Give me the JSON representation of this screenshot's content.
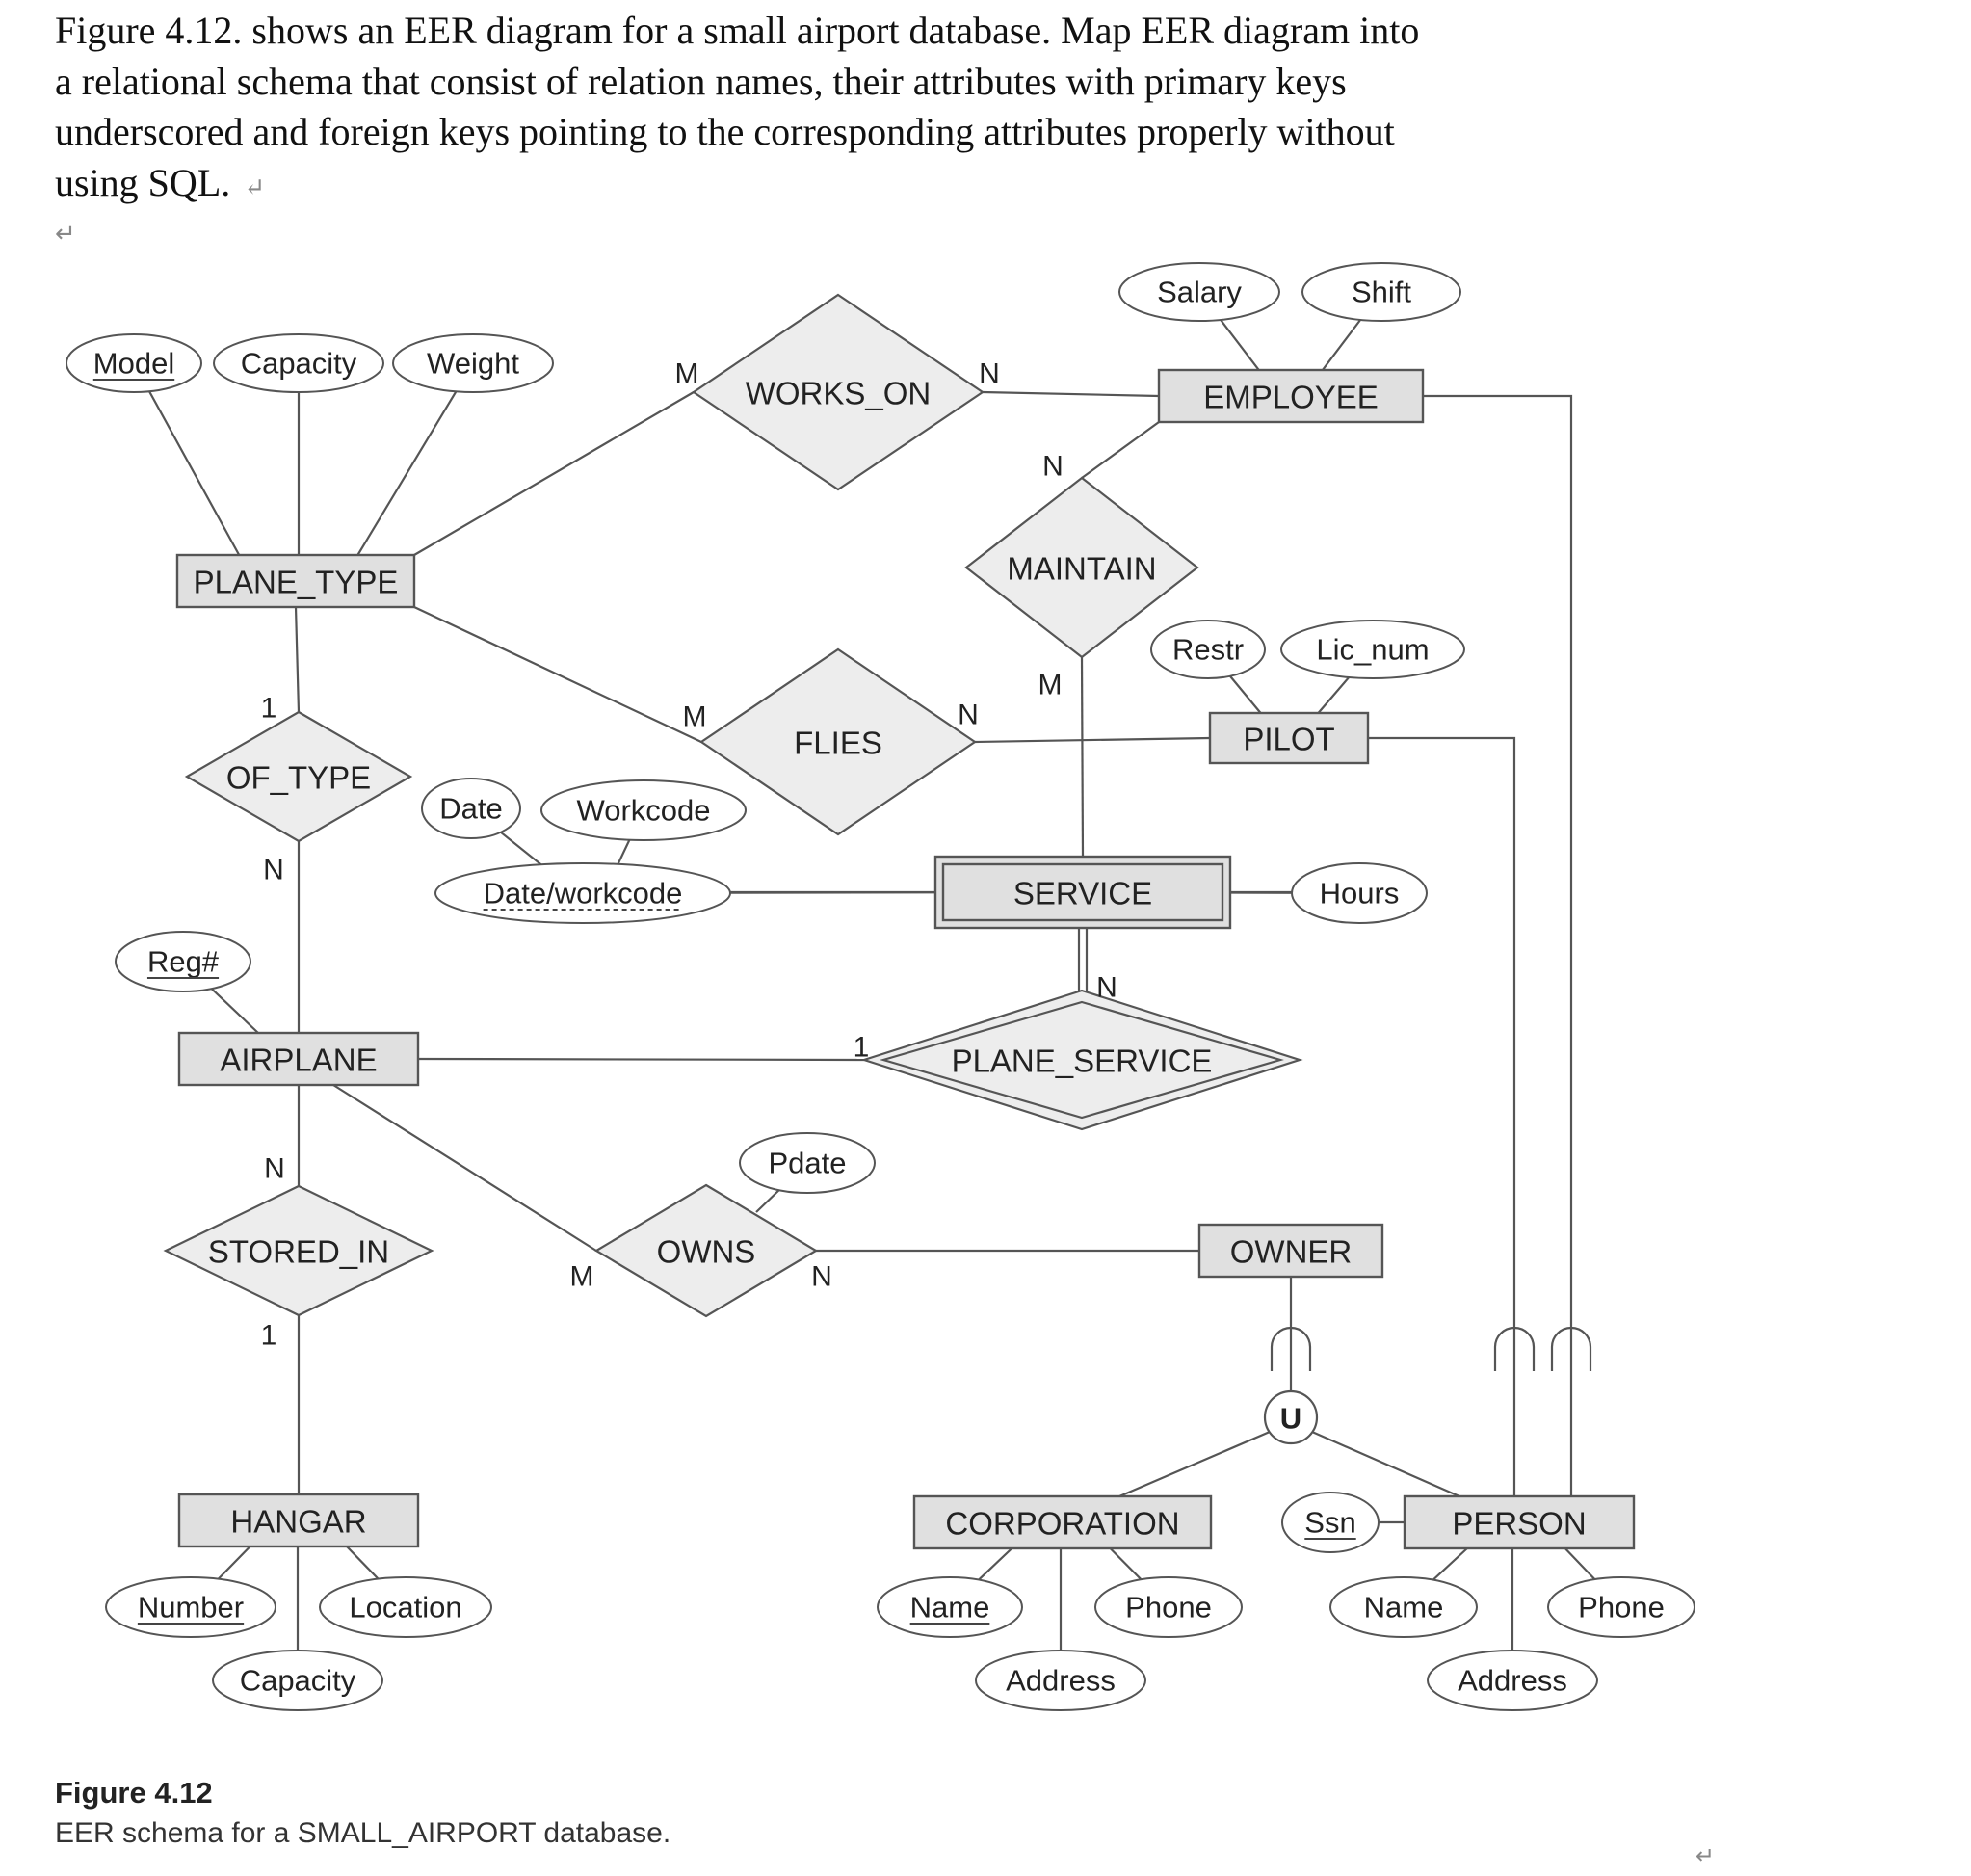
{
  "question": {
    "lines": [
      "Figure 4.12. shows an EER diagram for a small airport database. Map EER diagram into",
      "a relational schema that consist of relation names, their attributes with primary keys",
      "underscored and foreign keys pointing to the corresponding attributes properly without",
      "using SQL."
    ],
    "paragraph_mark": "↵"
  },
  "diagram": {
    "entities": [
      {
        "id": "PLANE_TYPE",
        "label": "PLANE_TYPE",
        "weak": false
      },
      {
        "id": "EMPLOYEE",
        "label": "EMPLOYEE",
        "weak": false
      },
      {
        "id": "PILOT",
        "label": "PILOT",
        "weak": false
      },
      {
        "id": "SERVICE",
        "label": "SERVICE",
        "weak": true
      },
      {
        "id": "AIRPLANE",
        "label": "AIRPLANE",
        "weak": false
      },
      {
        "id": "OWNER",
        "label": "OWNER",
        "weak": false
      },
      {
        "id": "HANGAR",
        "label": "HANGAR",
        "weak": false
      },
      {
        "id": "CORPORATION",
        "label": "CORPORATION",
        "weak": false
      },
      {
        "id": "PERSON",
        "label": "PERSON",
        "weak": false
      }
    ],
    "relationships": [
      {
        "id": "WORKS_ON",
        "label": "WORKS_ON",
        "identifying": false
      },
      {
        "id": "MAINTAIN",
        "label": "MAINTAIN",
        "identifying": false
      },
      {
        "id": "FLIES",
        "label": "FLIES",
        "identifying": false
      },
      {
        "id": "OF_TYPE",
        "label": "OF_TYPE",
        "identifying": false
      },
      {
        "id": "PLANE_SERVICE",
        "label": "PLANE_SERVICE",
        "identifying": true
      },
      {
        "id": "STORED_IN",
        "label": "STORED_IN",
        "identifying": false
      },
      {
        "id": "OWNS",
        "label": "OWNS",
        "identifying": false
      }
    ],
    "attributes": [
      {
        "id": "pt_model",
        "owner": "PLANE_TYPE",
        "label": "Model",
        "key": "primary"
      },
      {
        "id": "pt_capacity",
        "owner": "PLANE_TYPE",
        "label": "Capacity",
        "key": "none"
      },
      {
        "id": "pt_weight",
        "owner": "PLANE_TYPE",
        "label": "Weight",
        "key": "none"
      },
      {
        "id": "emp_salary",
        "owner": "EMPLOYEE",
        "label": "Salary",
        "key": "none"
      },
      {
        "id": "emp_shift",
        "owner": "EMPLOYEE",
        "label": "Shift",
        "key": "none"
      },
      {
        "id": "pil_restr",
        "owner": "PILOT",
        "label": "Restr",
        "key": "none"
      },
      {
        "id": "pil_lic",
        "owner": "PILOT",
        "label": "Lic_num",
        "key": "none"
      },
      {
        "id": "svc_date",
        "owner": "svc_dw",
        "label": "Date",
        "key": "none"
      },
      {
        "id": "svc_workcode",
        "owner": "svc_dw",
        "label": "Workcode",
        "key": "none"
      },
      {
        "id": "svc_dw",
        "owner": "SERVICE",
        "label": "Date/workcode",
        "key": "partial"
      },
      {
        "id": "svc_hours",
        "owner": "SERVICE",
        "label": "Hours",
        "key": "none"
      },
      {
        "id": "ap_reg",
        "owner": "AIRPLANE",
        "label": "Reg#",
        "key": "primary"
      },
      {
        "id": "owns_pdate",
        "owner": "OWNS",
        "label": "Pdate",
        "key": "none"
      },
      {
        "id": "hg_number",
        "owner": "HANGAR",
        "label": "Number",
        "key": "primary"
      },
      {
        "id": "hg_location",
        "owner": "HANGAR",
        "label": "Location",
        "key": "none"
      },
      {
        "id": "hg_capacity",
        "owner": "HANGAR",
        "label": "Capacity",
        "key": "none"
      },
      {
        "id": "corp_name",
        "owner": "CORPORATION",
        "label": "Name",
        "key": "primary"
      },
      {
        "id": "corp_phone",
        "owner": "CORPORATION",
        "label": "Phone",
        "key": "none"
      },
      {
        "id": "corp_address",
        "owner": "CORPORATION",
        "label": "Address",
        "key": "none"
      },
      {
        "id": "per_ssn",
        "owner": "PERSON",
        "label": "Ssn",
        "key": "primary"
      },
      {
        "id": "per_name",
        "owner": "PERSON",
        "label": "Name",
        "key": "none"
      },
      {
        "id": "per_phone",
        "owner": "PERSON",
        "label": "Phone",
        "key": "none"
      },
      {
        "id": "per_address",
        "owner": "PERSON",
        "label": "Address",
        "key": "none"
      }
    ],
    "cardinalities": [
      {
        "id": "c_wo_pt",
        "relationship": "WORKS_ON",
        "entity": "PLANE_TYPE",
        "label": "M"
      },
      {
        "id": "c_wo_emp",
        "relationship": "WORKS_ON",
        "entity": "EMPLOYEE",
        "label": "N"
      },
      {
        "id": "c_mt_emp",
        "relationship": "MAINTAIN",
        "entity": "EMPLOYEE",
        "label": "N"
      },
      {
        "id": "c_mt_svc",
        "relationship": "MAINTAIN",
        "entity": "SERVICE",
        "label": "M"
      },
      {
        "id": "c_fl_pt",
        "relationship": "FLIES",
        "entity": "PLANE_TYPE",
        "label": "M"
      },
      {
        "id": "c_fl_pil",
        "relationship": "FLIES",
        "entity": "PILOT",
        "label": "N"
      },
      {
        "id": "c_ot_pt",
        "relationship": "OF_TYPE",
        "entity": "PLANE_TYPE",
        "label": "1"
      },
      {
        "id": "c_ot_ap",
        "relationship": "OF_TYPE",
        "entity": "AIRPLANE",
        "label": "N"
      },
      {
        "id": "c_ps_svc",
        "relationship": "PLANE_SERVICE",
        "entity": "SERVICE",
        "label": "N"
      },
      {
        "id": "c_ps_ap",
        "relationship": "PLANE_SERVICE",
        "entity": "AIRPLANE",
        "label": "1"
      },
      {
        "id": "c_si_ap",
        "relationship": "STORED_IN",
        "entity": "AIRPLANE",
        "label": "N"
      },
      {
        "id": "c_si_hg",
        "relationship": "STORED_IN",
        "entity": "HANGAR",
        "label": "1"
      },
      {
        "id": "c_ow_ap",
        "relationship": "OWNS",
        "entity": "AIRPLANE",
        "label": "M"
      },
      {
        "id": "c_ow_own",
        "relationship": "OWNS",
        "entity": "OWNER",
        "label": "N"
      }
    ],
    "union": {
      "label": "U",
      "superclass": "OWNER",
      "subclasses": [
        "CORPORATION",
        "PERSON"
      ]
    },
    "subclass_links": [
      {
        "sub": "PILOT",
        "super": "PERSON"
      },
      {
        "sub": "EMPLOYEE",
        "super": "PERSON"
      }
    ]
  },
  "caption": {
    "title": "Figure 4.12",
    "text": "EER schema for a SMALL_AIRPORT database.",
    "paragraph_mark": "↵"
  }
}
